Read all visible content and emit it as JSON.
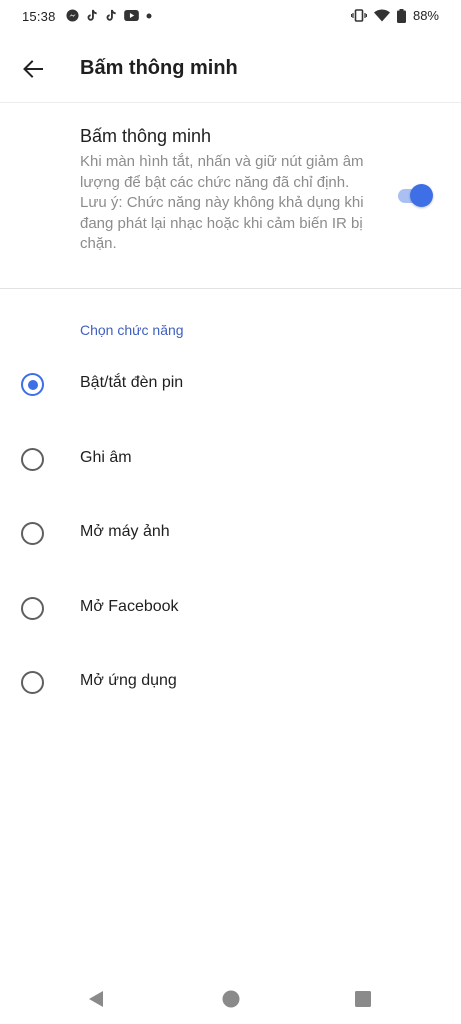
{
  "status_bar": {
    "time": "15:38",
    "battery_percent": "88%",
    "left_icons": [
      "messenger-icon",
      "tiktok-icon",
      "tiktok-icon",
      "youtube-icon",
      "dot-icon"
    ],
    "right_icons": [
      "vibrate-icon",
      "wifi-icon",
      "battery-icon"
    ]
  },
  "app_bar": {
    "title": "Bấm thông minh",
    "back_icon": "arrow-left-icon"
  },
  "smart_key": {
    "title": "Bấm thông minh",
    "description_line1": "Khi màn hình tắt, nhấn và giữ nút giảm âm lượng để bật các chức năng đã chỉ định.",
    "description_line2": "Lưu ý: Chức năng này không khả dụng khi đang phát lại nhạc hoặc khi cảm biến IR bị chặn.",
    "enabled": true,
    "accent_color": "#3f6fe6"
  },
  "functions": {
    "header": "Chọn chức năng",
    "options": [
      {
        "label": "Bật/tắt đèn pin",
        "selected": true
      },
      {
        "label": "Ghi âm",
        "selected": false
      },
      {
        "label": "Mở máy ảnh",
        "selected": false
      },
      {
        "label": "Mở Facebook",
        "selected": false
      },
      {
        "label": "Mở ứng dụng",
        "selected": false
      }
    ]
  },
  "nav_bar": {
    "buttons": [
      "back-triangle-icon",
      "home-circle-icon",
      "recents-square-icon"
    ]
  }
}
